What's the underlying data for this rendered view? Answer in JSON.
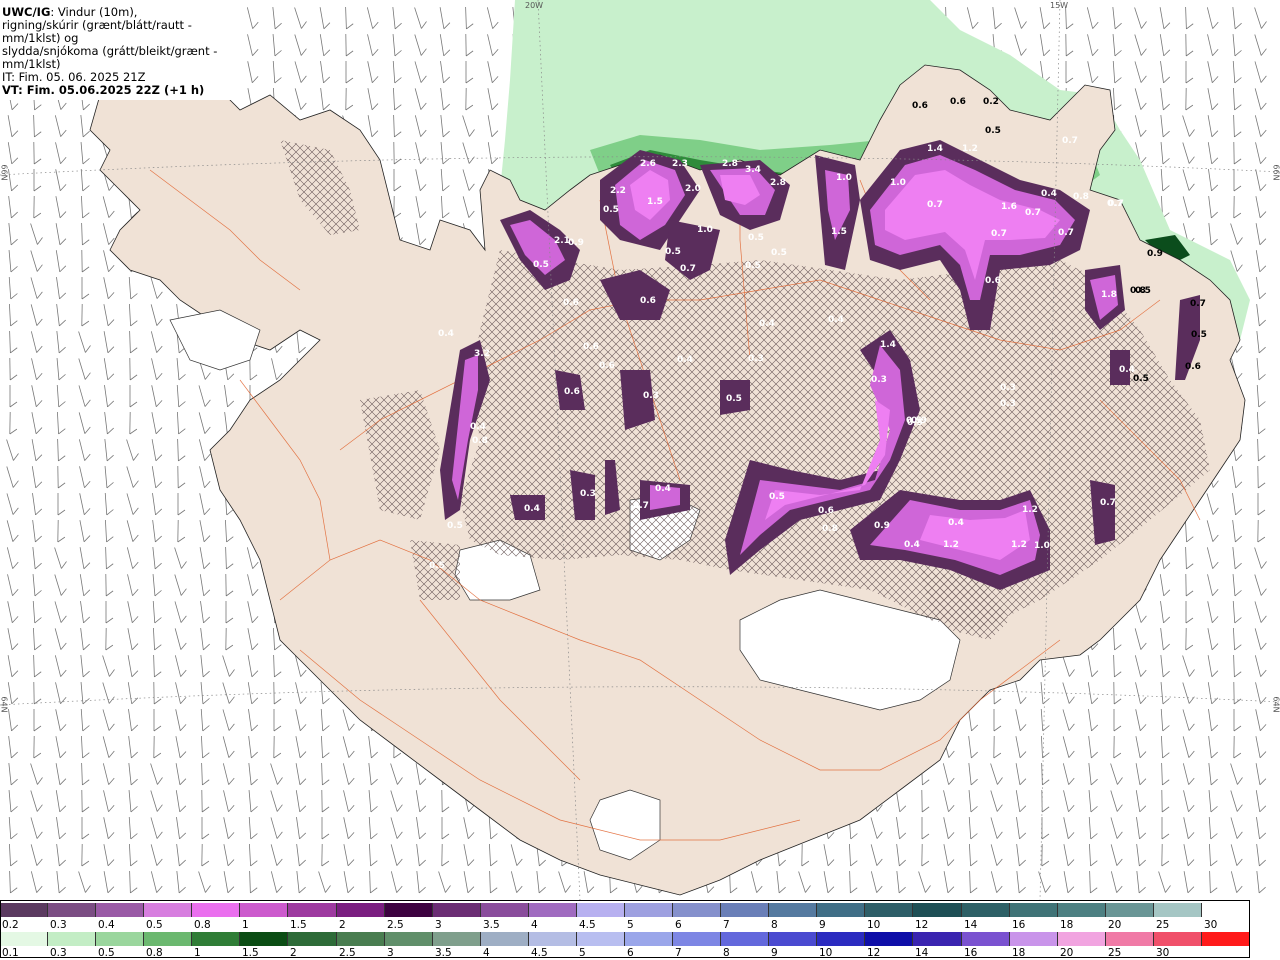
{
  "title": {
    "model": "UWC/IG",
    "line1_rest": ": Vindur (10m),",
    "line2": "rigning/skúrir (grænt/blátt/rautt - mm/1klst) og",
    "line3": "slydda/snjókoma (grátt/bleikt/grænt - mm/1klst)",
    "line4": "IT: Fim. 05. 06. 2025 21Z",
    "line5": "VT: Fim. 05.06.2025 22Z (+1 h)"
  },
  "grid_labels": {
    "lon_20w": "20W",
    "lon_15w": "15W",
    "lat_66n_left": "66N",
    "lat_66n_right": "66N",
    "lat_64n_left": "64N",
    "lat_64n_right": "64N"
  },
  "colors": {
    "land": "#f0e2d6",
    "rain_light": "#c8f0cc",
    "rain_green": "#2e8b3a",
    "rain_dark": "#0b4d1c",
    "snow_dark": "#5a2d5c",
    "snow_mid": "#b45bbf",
    "snow_bright": "#ee7ff2",
    "road": "#e0602a"
  },
  "precip_labels": [
    "0.6",
    "0.6",
    "0.2",
    "0.5",
    "1.4",
    "1.2",
    "0.7",
    "2.6",
    "2.3",
    "2.8",
    "3.4",
    "2.8",
    "1.0",
    "2.2",
    "1.5",
    "2.0",
    "1.0",
    "0.5",
    "0.7",
    "1.0",
    "1.6",
    "0.7",
    "0.4",
    "0.7",
    "0.8",
    "0.7",
    "0.7",
    "2.1",
    "0.9",
    "0.5",
    "0.7",
    "1.5",
    "0.5",
    "0.5",
    "0.5",
    "0.6",
    "0.6",
    "1.8",
    "0.5",
    "0.9",
    "0.7",
    "0.5",
    "0.6",
    "0.4",
    "0.4",
    "0.4",
    "0.3",
    "1.4",
    "0.3",
    "0.9",
    "0.5",
    "0.3",
    "0.3",
    "0.5",
    "0.4",
    "3.2",
    "0.6",
    "0.6",
    "0.3",
    "0.5",
    "0.6",
    "0.5",
    "0.4",
    "0.4",
    "0.8",
    "0.4",
    "0.3",
    "0.7",
    "0.4",
    "0.5",
    "0.6",
    "0.8",
    "0.9",
    "0.4",
    "0.4",
    "1.2",
    "1.2",
    "1.2",
    "1.0",
    "0.7",
    "0.5",
    "0.6",
    "0.5",
    "0.5",
    "0.8",
    "0.7"
  ],
  "legend_top": {
    "colors": [
      "#5b3a60",
      "#7b4d83",
      "#9a5aa6",
      "#d77edf",
      "#ea6fee",
      "#cc5acd",
      "#9e3aa0",
      "#7a1e80",
      "#3d0240",
      "#6b2d74",
      "#8a4d9c",
      "#a06bc0",
      "#b7b0f0",
      "#9ea0e0",
      "#8590cc",
      "#6a7fb8",
      "#557aa0",
      "#3f6e86",
      "#2e5e68",
      "#1e4f55",
      "#2d6066",
      "#3f7377",
      "#4d8082",
      "#6a9696",
      "#a5c6c4",
      "#ffffff"
    ],
    "labels": [
      "0.2",
      "0.3",
      "0.4",
      "0.5",
      "0.8",
      "1",
      "1.5",
      "2",
      "2.5",
      "3",
      "3.5",
      "4",
      "4.5",
      "5",
      "6",
      "7",
      "8",
      "9",
      "10",
      "12",
      "14",
      "16",
      "18",
      "20",
      "25",
      "30"
    ]
  },
  "legend_bottom": {
    "colors": [
      "#e4f8e4",
      "#c3edc5",
      "#9ad69d",
      "#6bb86f",
      "#2f7d36",
      "#0b4d14",
      "#2d6b38",
      "#497d50",
      "#608f6a",
      "#7f9f8c",
      "#9eaec4",
      "#b4bde4",
      "#b8bef0",
      "#9aa6ea",
      "#7d86e4",
      "#6368dc",
      "#4a4ad0",
      "#2b2bc0",
      "#0e0ea8",
      "#3a24b0",
      "#7a52d0",
      "#c994ea",
      "#f1a4e0",
      "#f07aa6",
      "#f0506a",
      "#ff1a1a"
    ],
    "labels": [
      "0.1",
      "0.3",
      "0.5",
      "0.8",
      "1",
      "1.5",
      "2",
      "2.5",
      "3",
      "3.5",
      "4",
      "4.5",
      "5",
      "6",
      "7",
      "8",
      "9",
      "10",
      "12",
      "14",
      "16",
      "18",
      "20",
      "25",
      "30"
    ]
  }
}
